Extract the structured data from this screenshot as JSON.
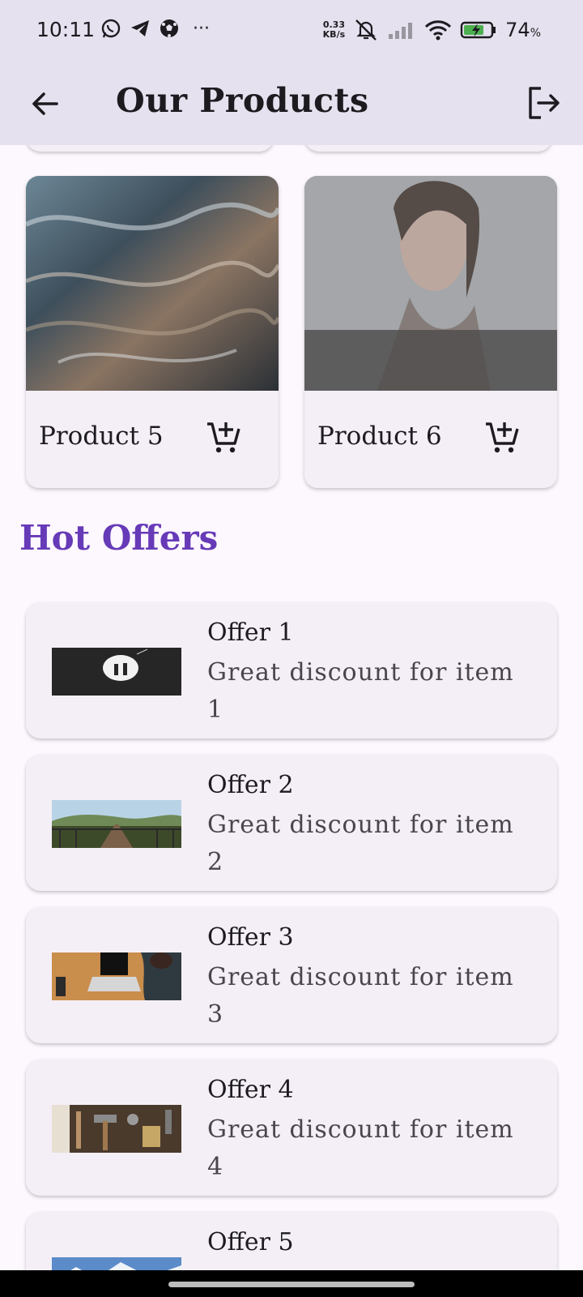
{
  "status_bar": {
    "time": "10:11",
    "network_speed_value": "0.33",
    "network_speed_unit": "KB/s",
    "battery_percent": "74",
    "battery_percent_sign": "%"
  },
  "app_bar": {
    "title": "Our Products"
  },
  "products": [
    {
      "name": "Product 5"
    },
    {
      "name": "Product 6"
    }
  ],
  "hot_offers": {
    "title": "Hot Offers",
    "items": [
      {
        "title": "Offer 1",
        "description": "Great discount for item 1"
      },
      {
        "title": "Offer 2",
        "description": "Great discount for item 2"
      },
      {
        "title": "Offer 3",
        "description": "Great discount for item 3"
      },
      {
        "title": "Offer 4",
        "description": "Great discount for item 4"
      },
      {
        "title": "Offer 5",
        "description": ""
      }
    ]
  },
  "colors": {
    "app_bar_bg": "#e6e1ee",
    "page_bg": "#fdf7fe",
    "card_bg": "#f4eff6",
    "accent": "#673ab7"
  }
}
